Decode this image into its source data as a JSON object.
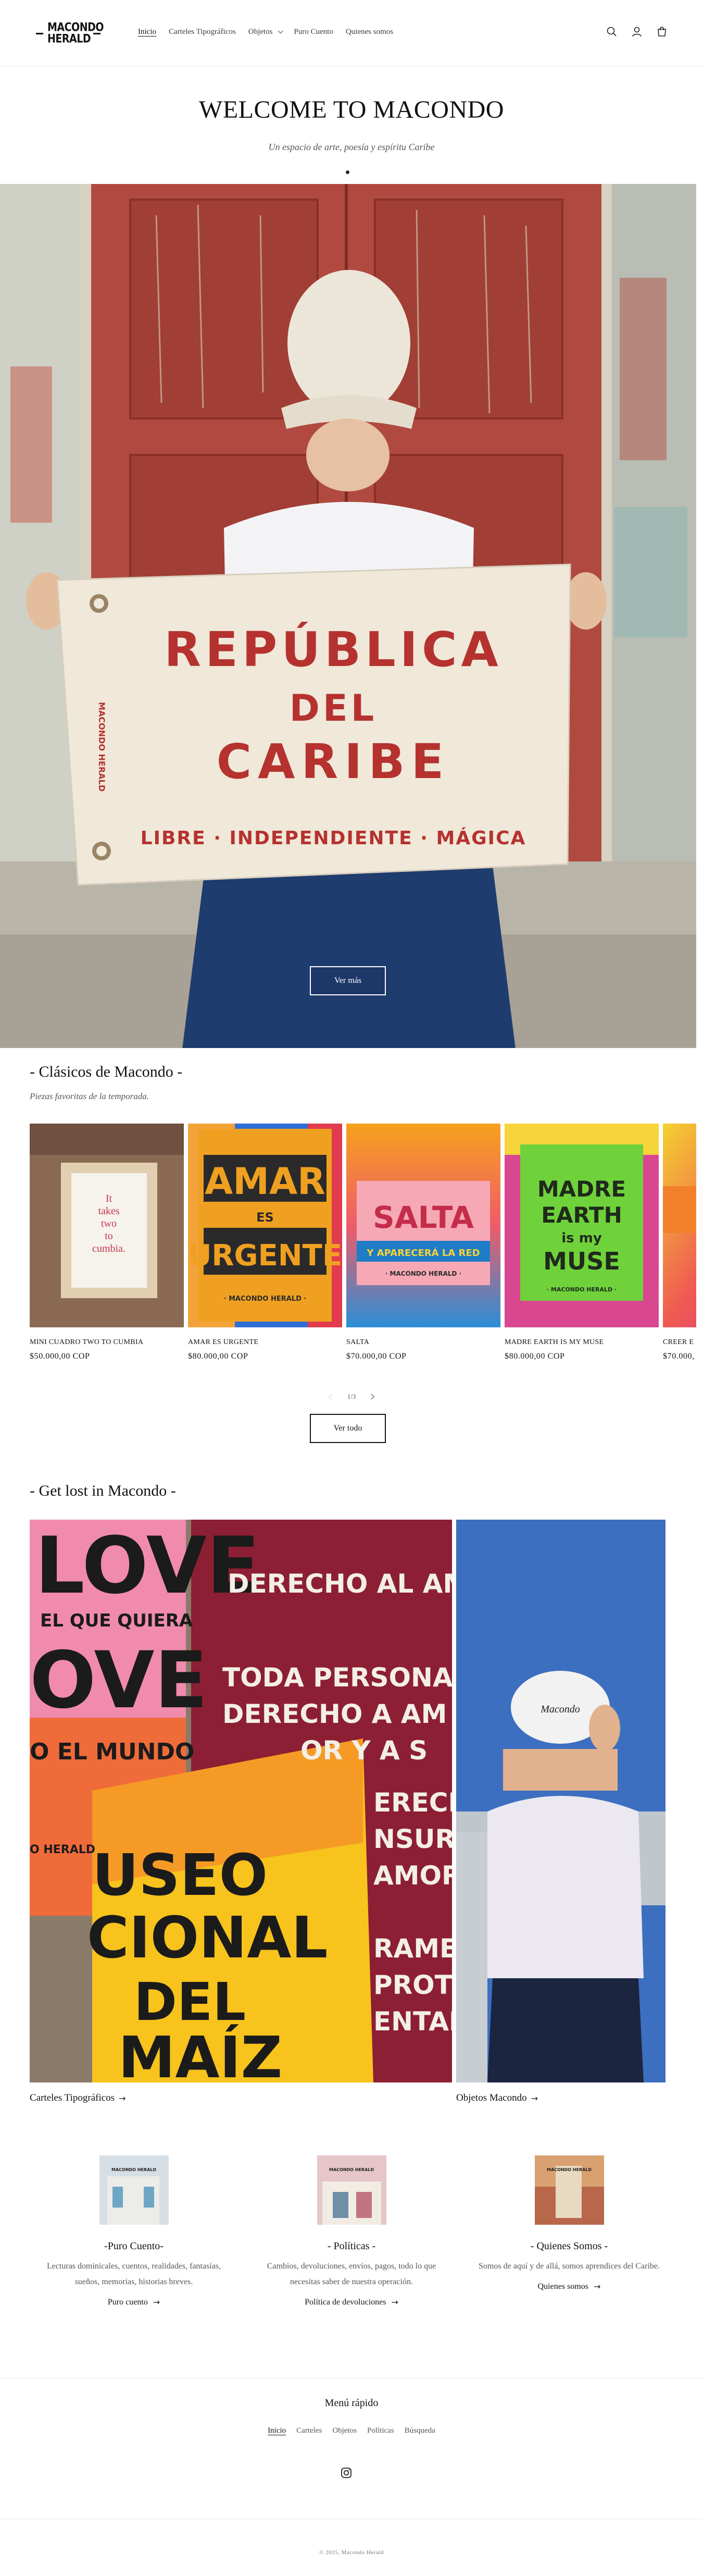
{
  "header": {
    "logo_text": "MACONDO HERALD",
    "nav": [
      {
        "label": "Inicio"
      },
      {
        "label": "Carteles Tipográficos"
      },
      {
        "label": "Objetos"
      },
      {
        "label": "Puro Cuento"
      },
      {
        "label": "Quienes somos"
      }
    ],
    "icons": [
      "search-icon",
      "account-icon",
      "cart-icon"
    ]
  },
  "hero": {
    "title": "WELCOME TO MACONDO",
    "subtitle": "Un espacio de arte, poesía y espíritu Caribe",
    "button_label": "Ver más",
    "flag_lines": [
      "REPÚBLICA",
      "DEL",
      "CARIBE",
      "LIBRE · INDEPENDIENTE · MÁGICA",
      "MACONDO HERALD"
    ]
  },
  "clasicos": {
    "title": "- Clásicos de Macondo -",
    "subtitle": "Piezas favoritas de la temporada.",
    "products": [
      {
        "name": "MINI CUADRO TWO TO CUMBIA",
        "price": "$50.000,00 COP",
        "art_text": [
          "It",
          "takes",
          "two",
          "to",
          "cumbia."
        ]
      },
      {
        "name": "AMAR ES URGENTE",
        "price": "$80.000,00 COP",
        "art_text": [
          "AMAR",
          "ES",
          "URGENTE",
          "· MACONDO HERALD ·"
        ]
      },
      {
        "name": "SALTA",
        "price": "$70.000,00 COP",
        "art_text": [
          "SALTA",
          "Y APARECERÁ LA RED",
          "· MACONDO HERALD ·"
        ]
      },
      {
        "name": "MADRE EARTH IS MY MUSE",
        "price": "$80.000,00 COP",
        "art_text": [
          "MADRE",
          "EARTH",
          "is my",
          "MUSE",
          "· MACONDO HERALD ·"
        ]
      },
      {
        "name": "CREER E",
        "price": "$70.000,"
      }
    ],
    "pager": "1/3",
    "view_all_label": "Ver todo"
  },
  "collage": {
    "title": "- Get lost in Macondo -",
    "left_link": "Carteles Tipográficos",
    "right_link": "Objetos Macondo",
    "poster_texts": [
      "LOVE",
      "EL QUE QUIERA",
      "OVE",
      "O EL MUNDO",
      "O HERALD",
      "DERECHO AL AM",
      "TODA PERSONA T",
      "DERECHO A AM",
      "OR Y A S",
      "USEO",
      "CIONAL",
      "DEL",
      "MAÍZ",
      "ERECH",
      "NSUR",
      "AMOR",
      "RAMEN",
      "PROT",
      "ENTAL"
    ],
    "cap_text": "Macondo"
  },
  "columns": [
    {
      "title": "-Puro Cuento-",
      "text": "Lecturas dominicales, cuentos, realidades, fantasías, sueños, memorias, historias breves.",
      "link": "Puro cuento",
      "thumb": "MACONDO HERALD"
    },
    {
      "title": "- Políticas -",
      "text": "Cambios, devoluciones, envíos, pagos, todo lo que necesitas saber de nuestra operación.",
      "link": "Política de devoluciones",
      "thumb": "MACONDO HERALD"
    },
    {
      "title": "- Quienes Somos -",
      "text": "Somos de aquí y de allá, somos aprendices del Caribe.",
      "link": "Quienes somos",
      "thumb": "MACONDO HERALD"
    }
  ],
  "footer": {
    "title": "Menú rápido",
    "nav": [
      "Inicio",
      "Carteles",
      "Objetos",
      "Políticas",
      "Búsqueda"
    ],
    "social_icon": "instagram-icon",
    "copyright": "© 2025, Macondo Herald"
  },
  "colors": {
    "text": "#121212",
    "muted": "#555555",
    "border": "#e6e6e6",
    "door_red": "#b8463f",
    "flag_text": "#b5322f"
  }
}
